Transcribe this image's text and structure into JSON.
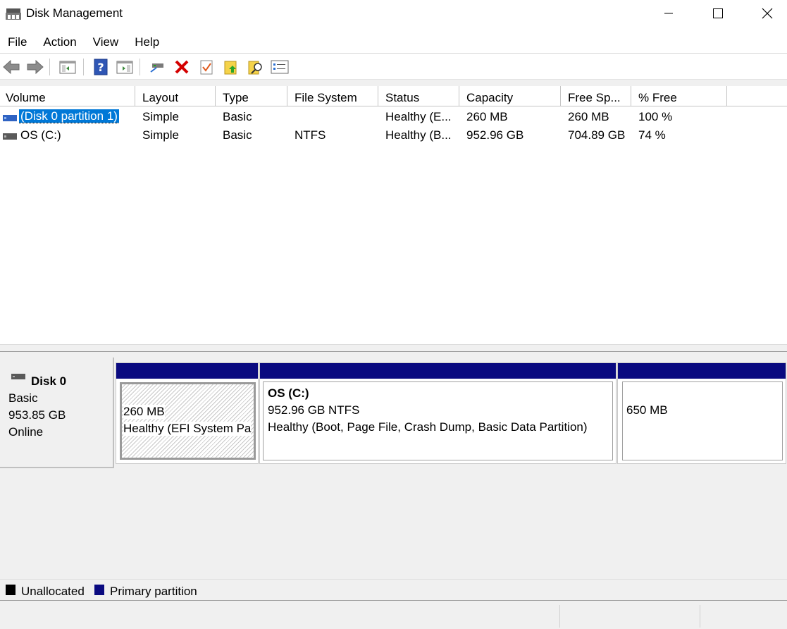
{
  "window": {
    "title": "Disk Management",
    "minimize_label": "Minimize",
    "maximize_label": "Maximize",
    "close_label": "Close"
  },
  "menu": [
    "File",
    "Action",
    "View",
    "Help"
  ],
  "toolbar": {
    "buttons": [
      "back-icon",
      "forward-icon",
      "show-hide-console-tree-icon",
      "help-icon",
      "show-hide-action-pane-icon",
      "connect-virtual-disk-icon",
      "delete-icon",
      "check-icon",
      "refresh-folder-icon",
      "search-folder-icon",
      "properties-list-icon"
    ]
  },
  "volume_list": {
    "columns": [
      "Volume",
      "Layout",
      "Type",
      "File System",
      "Status",
      "Capacity",
      "Free Sp...",
      "% Free"
    ],
    "rows": [
      {
        "volume": "(Disk 0 partition 1)",
        "layout": "Simple",
        "type": "Basic",
        "file_system": "",
        "status": "Healthy (E...",
        "capacity": "260 MB",
        "free_space": "260 MB",
        "percent_free": "100 %",
        "selected": true
      },
      {
        "volume": "OS (C:)",
        "layout": "Simple",
        "type": "Basic",
        "file_system": "NTFS",
        "status": "Healthy (B...",
        "capacity": "952.96 GB",
        "free_space": "704.89 GB",
        "percent_free": "74 %",
        "selected": false
      }
    ]
  },
  "disk": {
    "name": "Disk 0",
    "type": "Basic",
    "size": "953.85 GB",
    "state": "Online",
    "partitions": [
      {
        "name": "",
        "size_line": "260 MB",
        "status_line": "Healthy (EFI System Pa"
      },
      {
        "name": "OS  (C:)",
        "size_line": "952.96 GB NTFS",
        "status_line": "Healthy (Boot, Page File, Crash Dump, Basic Data Partition)"
      },
      {
        "name": "",
        "size_line": "650 MB",
        "status_line": ""
      }
    ]
  },
  "legend": {
    "items": [
      {
        "label": "Unallocated",
        "color": "#000000"
      },
      {
        "label": "Primary partition",
        "color": "#0a0a80"
      }
    ]
  },
  "colors": {
    "selection": "#0078d7",
    "partition_header": "#0a0a80",
    "delete_red": "#d40000"
  }
}
